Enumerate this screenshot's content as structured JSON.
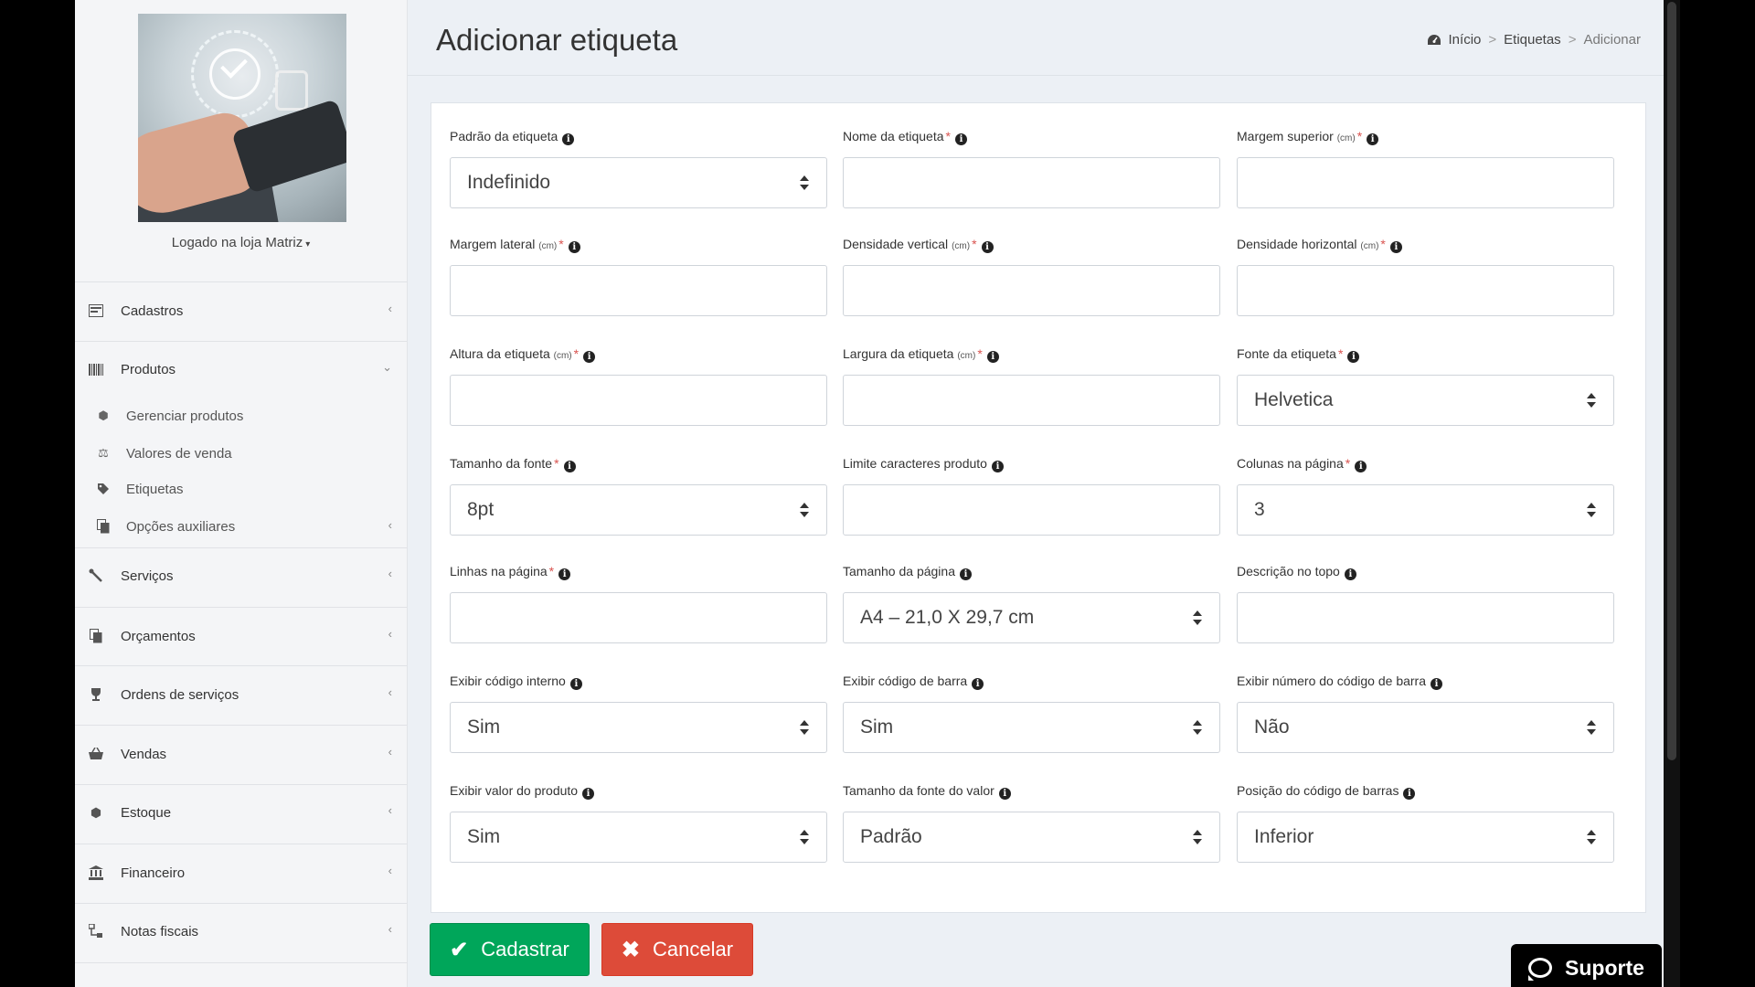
{
  "sidebar": {
    "logged_prefix": "Logado na loja ",
    "store_name": "Matriz",
    "items": [
      {
        "name": "cadastros",
        "label": "Cadastros",
        "icon": "list-card-icon"
      },
      {
        "name": "produtos",
        "label": "Produtos",
        "icon": "barcode-icon",
        "expanded": true
      },
      {
        "name": "servicos",
        "label": "Serviços",
        "icon": "wrench-icon"
      },
      {
        "name": "orcamentos",
        "label": "Orçamentos",
        "icon": "copy-icon"
      },
      {
        "name": "ordens",
        "label": "Ordens de serviços",
        "icon": "trophy-icon"
      },
      {
        "name": "vendas",
        "label": "Vendas",
        "icon": "basket-icon"
      },
      {
        "name": "estoque",
        "label": "Estoque",
        "icon": "cubes-icon"
      },
      {
        "name": "financeiro",
        "label": "Financeiro",
        "icon": "bank-icon"
      },
      {
        "name": "notas",
        "label": "Notas fiscais",
        "icon": "sitemap-icon"
      }
    ],
    "produtos_sub": [
      {
        "label": "Gerenciar produtos",
        "icon": "cubes-icon"
      },
      {
        "label": "Valores de venda",
        "icon": "balance-scale-icon"
      },
      {
        "label": "Etiquetas",
        "icon": "tag-icon"
      },
      {
        "label": "Opções auxiliares",
        "icon": "copy-icon"
      }
    ]
  },
  "header": {
    "title": "Adicionar etiqueta",
    "breadcrumb": [
      "Início",
      "Etiquetas",
      "Adicionar"
    ]
  },
  "form": {
    "f1": {
      "label": "Padrão da etiqueta",
      "value": "Indefinido"
    },
    "f2": {
      "label": "Nome da etiqueta",
      "value": ""
    },
    "f3": {
      "label": "Margem superior",
      "unit": "(cm)",
      "value": ""
    },
    "f4": {
      "label": "Margem lateral",
      "unit": "(cm)",
      "value": ""
    },
    "f5": {
      "label": "Densidade vertical",
      "unit": "(cm)",
      "value": ""
    },
    "f6": {
      "label": "Densidade horizontal",
      "unit": "(cm)",
      "value": ""
    },
    "f7": {
      "label": "Altura da etiqueta",
      "unit": "(cm)",
      "value": ""
    },
    "f8": {
      "label": "Largura da etiqueta",
      "unit": "(cm)",
      "value": ""
    },
    "f9": {
      "label": "Fonte da etiqueta",
      "value": "Helvetica"
    },
    "f10": {
      "label": "Tamanho da fonte",
      "value": "8pt"
    },
    "f11": {
      "label": "Limite caracteres produto",
      "value": ""
    },
    "f12": {
      "label": "Colunas na página",
      "value": "3"
    },
    "f13": {
      "label": "Linhas na página",
      "value": ""
    },
    "f14": {
      "label": "Tamanho da página",
      "value": "A4 – 21,0 X 29,7 cm"
    },
    "f15": {
      "label": "Descrição no topo",
      "value": ""
    },
    "f16": {
      "label": "Exibir código interno",
      "value": "Sim"
    },
    "f17": {
      "label": "Exibir código de barra",
      "value": "Sim"
    },
    "f18": {
      "label": "Exibir número do código de barra",
      "value": "Não"
    },
    "f19": {
      "label": "Exibir valor do produto",
      "value": "Sim"
    },
    "f20": {
      "label": "Tamanho da fonte do valor",
      "value": "Padrão"
    },
    "f21": {
      "label": "Posição do código de barras",
      "value": "Inferior"
    }
  },
  "required_marker": "*",
  "info_glyph": "i",
  "buttons": {
    "save": "Cadastrar",
    "cancel": "Cancelar"
  },
  "support": {
    "label": "Suporte"
  },
  "colors": {
    "save": "#00a65a",
    "cancel": "#dd4b39",
    "required": "#d9534f"
  }
}
